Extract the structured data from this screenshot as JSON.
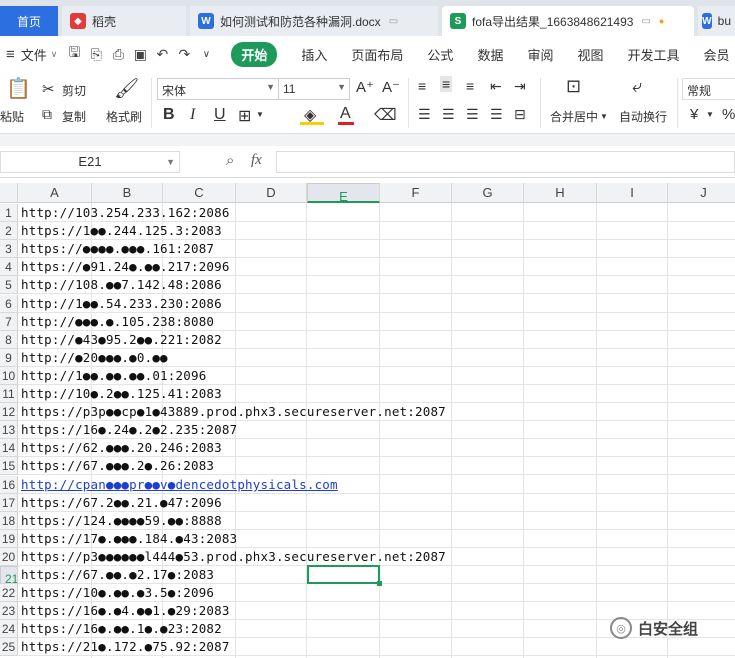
{
  "tabs": [
    {
      "label": "首页"
    },
    {
      "label": "稻壳"
    },
    {
      "label": "如何测试和防范各种漏洞.docx"
    },
    {
      "label": "fofa导出结果_1663848621493"
    },
    {
      "label": "bu"
    }
  ],
  "menu": {
    "file": "文件",
    "items": [
      "开始",
      "插入",
      "页面布局",
      "公式",
      "数据",
      "审阅",
      "视图",
      "开发工具",
      "会员"
    ]
  },
  "ribbon": {
    "paste": "粘贴",
    "cut": "剪切",
    "copy": "复制",
    "format_painter": "格式刷",
    "font_name": "宋体",
    "font_size": "11",
    "merge_center": "合并居中",
    "auto_wrap": "自动换行",
    "number_format": "常规",
    "currency_symbol": "¥",
    "percent_symbol": "%"
  },
  "formula_bar": {
    "name_box": "E21",
    "fx_label": "fx",
    "formula_value": ""
  },
  "sheet": {
    "columns": [
      "A",
      "B",
      "C",
      "D",
      "E",
      "F",
      "G",
      "H",
      "I",
      "J"
    ],
    "selected_column": "E",
    "selected_row": "21",
    "rows": [
      {
        "num": "1",
        "value": "http://103.254.233.162:2086"
      },
      {
        "num": "2",
        "value": "https://1●●.244.125.3:2083"
      },
      {
        "num": "3",
        "value": "https://●●●●.●●●.161:2087"
      },
      {
        "num": "4",
        "value": "https://●91.24●.●●.217:2096"
      },
      {
        "num": "5",
        "value": "http://108.●●7.142.48:2086"
      },
      {
        "num": "6",
        "value": "http://1●●.54.233.230:2086"
      },
      {
        "num": "7",
        "value": "http://●●●.●.105.238:8080"
      },
      {
        "num": "8",
        "value": "http://●43●95.2●●.221:2082"
      },
      {
        "num": "9",
        "value": "http://●20●●●.●0.●●"
      },
      {
        "num": "10",
        "value": "http://1●●.●●.●●.01:2096"
      },
      {
        "num": "11",
        "value": "http://10●.2●●.125.41:2083"
      },
      {
        "num": "12",
        "value": "https://p3p●●cp●1●43889.prod.phx3.secureserver.net:2087"
      },
      {
        "num": "13",
        "value": "https://16●.24●.2●2.235:2087"
      },
      {
        "num": "14",
        "value": "https://62.●●●.20.246:2083"
      },
      {
        "num": "15",
        "value": "https://67.●●●.2●.26:2083"
      },
      {
        "num": "16",
        "value": "http://cpan●●●pr●●v●dencedotphysicals.com"
      },
      {
        "num": "17",
        "value": "https://67.2●●.21.●47:2096"
      },
      {
        "num": "18",
        "value": "https://124.●●●●59.●●:8888"
      },
      {
        "num": "19",
        "value": "https://17●.●●●.184.●43:2083"
      },
      {
        "num": "20",
        "value": "https://p3●●●●●●l444●53.prod.phx3.secureserver.net:2087"
      },
      {
        "num": "21",
        "value": "https://67.●●.●2.17●:2083"
      },
      {
        "num": "22",
        "value": "https://10●.●●.●3.5●:2096"
      },
      {
        "num": "23",
        "value": "https://16●.●4.●●1.●29:2083"
      },
      {
        "num": "24",
        "value": "https://16●.●●.1●.●23:2082"
      },
      {
        "num": "25",
        "value": "https://21●.172.●75.92:2087"
      }
    ]
  },
  "watermark": {
    "text": "白安全组"
  },
  "colors": {
    "accent": "#1e9b5a",
    "home_tab": "#2b6fe0",
    "link": "#1c3fd1"
  }
}
